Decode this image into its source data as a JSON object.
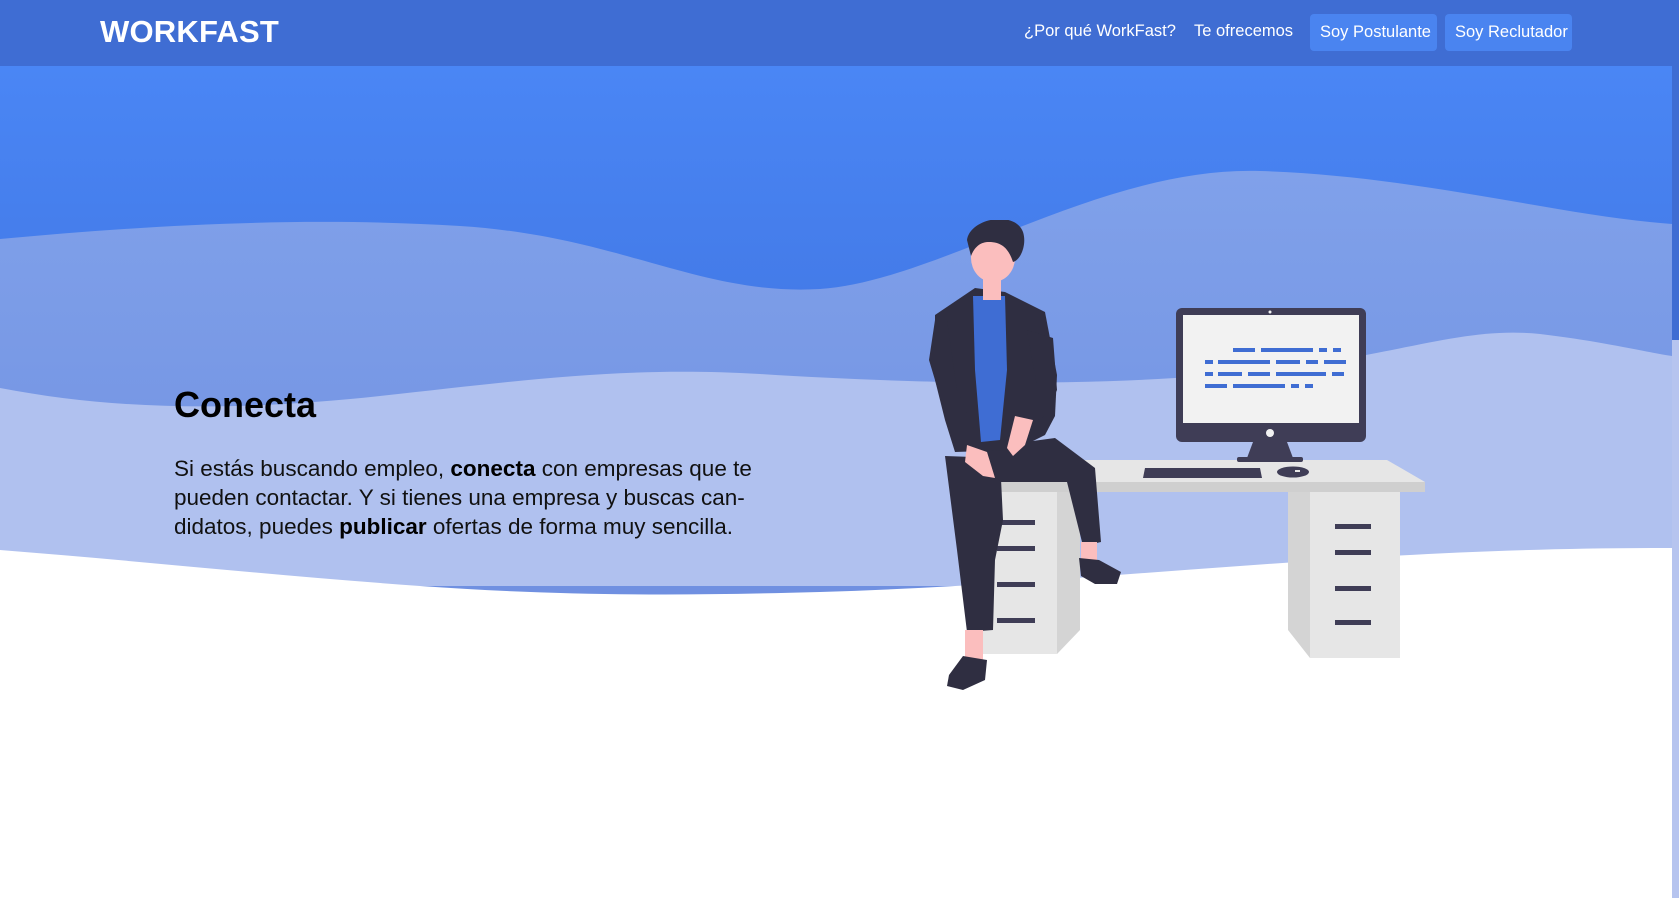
{
  "navbar": {
    "brand": "WORKFAST",
    "links": [
      "¿Por qué WorkFast?",
      "Te ofrecemos"
    ],
    "buttons": [
      "Soy Postulante",
      "Soy Reclutador"
    ]
  },
  "hero": {
    "title": "Conecta",
    "desc_part1": "Si estás buscando empleo, ",
    "desc_bold1": "conecta",
    "desc_part2": " con empresas que te pueden contactar. Y si tienes una empresa y buscas can­didatos, puedes ",
    "desc_bold2": "publicar",
    "desc_part3": " ofertas de forma muy sencilla."
  },
  "colors": {
    "navbar": "#3f6dd3",
    "button": "#4a84f0",
    "wave_dark": "#4480ef",
    "wave_mid": "#7a9be6",
    "wave_light": "#b0c1ef",
    "figure_dark": "#2f2e41",
    "figure_shirt": "#3f6dd3",
    "skin": "#fbbebe"
  },
  "icons": [
    "person-working-illustration",
    "desktop-computer-icon",
    "keyboard-icon",
    "mouse-icon"
  ]
}
